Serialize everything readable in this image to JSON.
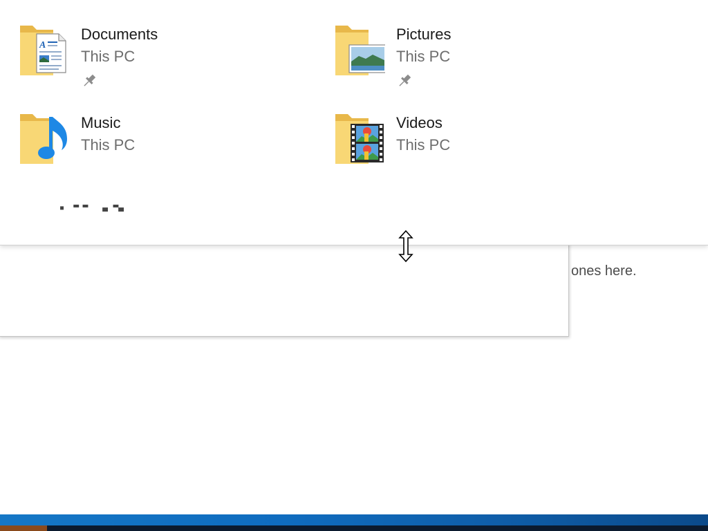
{
  "quick_access": {
    "items": [
      {
        "name": "Documents",
        "location": "This PC",
        "icon": "documents-folder-icon",
        "pinned": true
      },
      {
        "name": "Pictures",
        "location": "This PC",
        "icon": "pictures-folder-icon",
        "pinned": true
      },
      {
        "name": "Music",
        "location": "This PC",
        "icon": "music-folder-icon",
        "pinned": false
      },
      {
        "name": "Videos",
        "location": "This PC",
        "icon": "videos-folder-icon",
        "pinned": false
      }
    ]
  },
  "background_window": {
    "hint_text": "ones here.",
    "view_buttons": [
      {
        "icon": "details-view-icon"
      },
      {
        "icon": "large-icons-view-icon"
      }
    ]
  },
  "cursor": {
    "type": "vertical-resize-cursor"
  },
  "colors": {
    "folder": "#F8D775",
    "folder_dark": "#E8B84A",
    "taskbar": "#0F6CBF",
    "music_note": "#1E88E5"
  }
}
